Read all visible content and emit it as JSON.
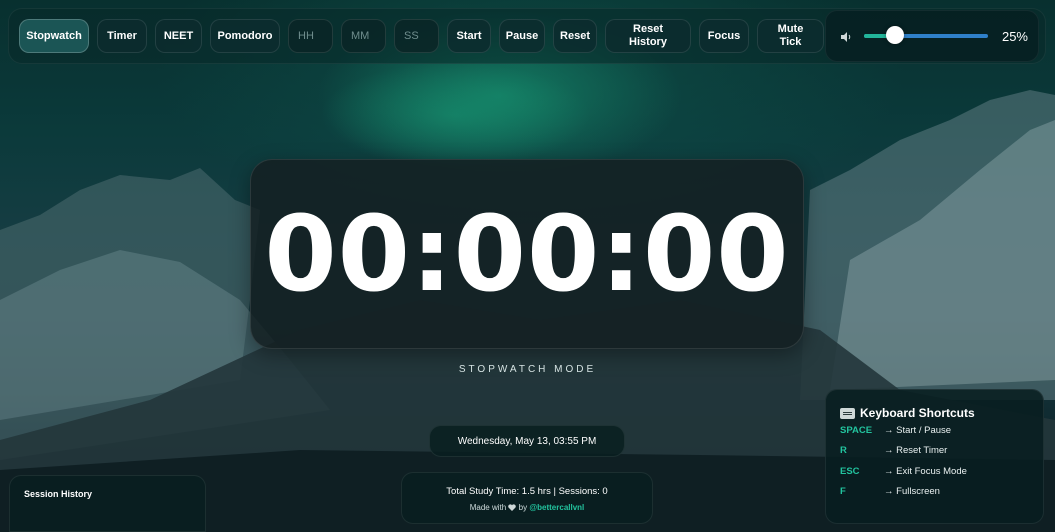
{
  "toolbar": {
    "modes": [
      {
        "label": "Stopwatch",
        "active": true
      },
      {
        "label": "Timer",
        "active": false
      },
      {
        "label": "NEET",
        "active": false
      },
      {
        "label": "Pomodoro",
        "active": false
      }
    ],
    "inputs": {
      "hh_placeholder": "HH",
      "mm_placeholder": "MM",
      "ss_placeholder": "SS"
    },
    "controls": {
      "start": "Start",
      "pause": "Pause",
      "reset": "Reset",
      "reset_history": "Reset\nHistory",
      "focus": "Focus",
      "mute_tick": "Mute\nTick"
    }
  },
  "volume": {
    "icon": "speaker-icon",
    "level": 0.25,
    "label": "25%"
  },
  "clock": {
    "time": "00:00:00",
    "mode_label": "STOPWATCH MODE"
  },
  "date_display": "Wednesday, May 13, 03:55 PM",
  "stats": {
    "summary": "Total Study Time: 1.5 hrs | Sessions: 0",
    "made_with_prefix": "Made with",
    "made_with_by": "by",
    "handle": "@bettercallvnl",
    "heart_icon": "heart-icon"
  },
  "history": {
    "title": "Session History"
  },
  "shortcuts": {
    "icon": "keyboard-icon",
    "title": "Keyboard Shortcuts",
    "items": [
      {
        "key": "SPACE",
        "desc": "→ Start / Pause"
      },
      {
        "key": "R",
        "desc": "→ Reset Timer"
      },
      {
        "key": "ESC",
        "desc": "→ Exit Focus Mode"
      },
      {
        "key": "F",
        "desc": "→ Fullscreen"
      }
    ]
  },
  "colors": {
    "accent": "#22c39e",
    "slider_track": "#2f80c9",
    "background": "#0b3a3b"
  }
}
